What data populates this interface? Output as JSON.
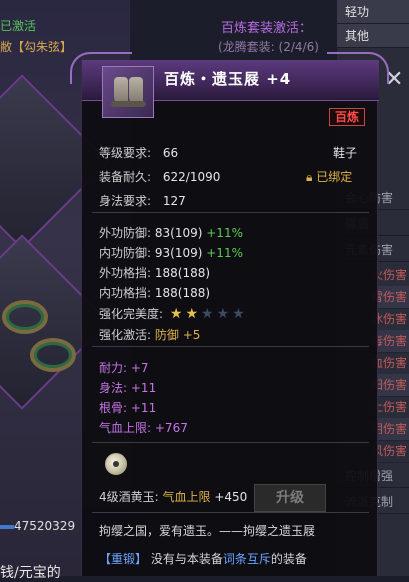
{
  "background": {
    "top_left_status": "已激活",
    "top_left_set": "敝【勾朱弦】",
    "set_bonus_title": "百炼套装激活：",
    "set_bonus_progress": "(龙腾套装: (2/4/6)",
    "right_menu": [
      "轻功",
      "其他"
    ],
    "right_labels": [
      "会心防害",
      "碾盾",
      "元素伤害"
    ],
    "right_sub": [
      "火伤害",
      "雷伤害",
      "冰伤害",
      "毒伤害",
      "血伤害",
      "阳伤害",
      "土伤害",
      "阴伤害",
      "风伤害"
    ],
    "right_bottom": [
      "控制增强",
      "流派克制"
    ],
    "left_bottom_number": "47520329",
    "left_bottom_text": "钱/元宝的"
  },
  "tooltip": {
    "title": "百炼・遗玉屐 +4",
    "quality_badge": "百炼",
    "level_req_label": "等级要求:",
    "level_req_value": "66",
    "slot": "鞋子",
    "durability_label": "装备耐久:",
    "durability_value": "622/1090",
    "bound_icon": "lock-icon",
    "bound_label": "已绑定",
    "agility_req_label": "身法要求:",
    "agility_req_value": "127",
    "defense": [
      {
        "label": "外功防御:",
        "value": "83(109)",
        "bonus": "+11%"
      },
      {
        "label": "内功防御:",
        "value": "93(109)",
        "bonus": "+11%"
      },
      {
        "label": "外功格挡:",
        "value": "188(188)",
        "bonus": ""
      },
      {
        "label": "内功格挡:",
        "value": "188(188)",
        "bonus": ""
      }
    ],
    "perfection_label": "强化完美度:",
    "perfection_stars": 2,
    "perfection_max": 5,
    "activation_label": "强化激活:",
    "activation_stat": "防御",
    "activation_bonus": "+5",
    "attributes": [
      {
        "label": "耐力:",
        "value": "+7"
      },
      {
        "label": "身法:",
        "value": "+11"
      },
      {
        "label": "根骨:",
        "value": "+11"
      },
      {
        "label": "气血上限:",
        "value": "+767"
      }
    ],
    "gem_label": "4级酒黄玉:",
    "gem_stat": "气血上限",
    "gem_value": "+450",
    "upgrade_button": "升级",
    "flavor_text": "拘缨之国，爱有遗玉。——拘缨之遗玉屐",
    "reforge_tag": "【重锻】",
    "reforge_text_a": "没有与本装备",
    "reforge_text_link": "词条互斥",
    "reforge_text_b": "的装备"
  },
  "colors": {
    "header_purple": "#5c3a7e",
    "green": "#5ccc50",
    "gold": "#e0b24a",
    "purple_attr": "#c774e8",
    "quality_red": "#ff4a4a",
    "blue": "#6aa6ff"
  }
}
